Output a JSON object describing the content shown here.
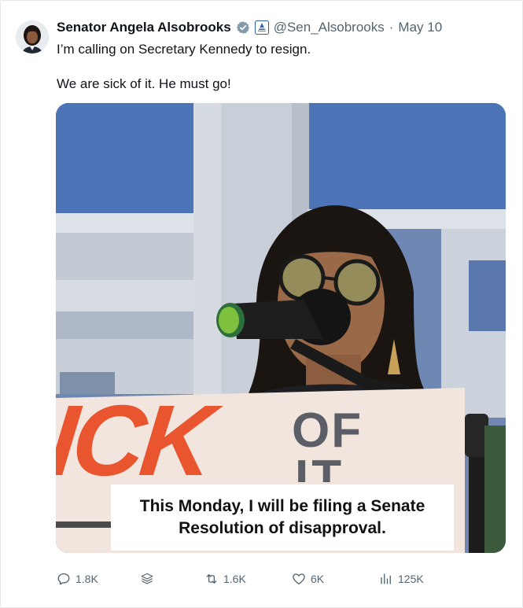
{
  "tweet": {
    "author_name": "Senator Angela Alsobrooks",
    "handle": "@Sen_Alsobrooks",
    "separator": "·",
    "date": "May 10",
    "text_line1": "I’m calling on Secretary Kennedy to resign.",
    "text_line2": "We are sick of it. He must go!"
  },
  "media": {
    "sign_left_text": "ICK",
    "sign_right_top": "OF",
    "sign_right_bottom": "IT",
    "caption_line1": "This Monday, I will be filing a Senate",
    "caption_line2": "Resolution of disapproval."
  },
  "actions": {
    "reply_count": "1.8K",
    "repost_count": "1.6K",
    "like_count": "6K",
    "views_count": "125K"
  },
  "icons": {
    "verified": "verified-badge-icon",
    "affiliate": "government-affiliate-icon",
    "reply": "reply-icon",
    "grok": "grok-icon",
    "repost": "repost-icon",
    "like": "heart-icon",
    "views": "views-icon"
  },
  "colors": {
    "text_primary": "#0f1419",
    "text_secondary": "#536471",
    "verified_badge": "#829aab",
    "sign_orange": "#e8552f",
    "sign_gray": "#5b5e66"
  }
}
